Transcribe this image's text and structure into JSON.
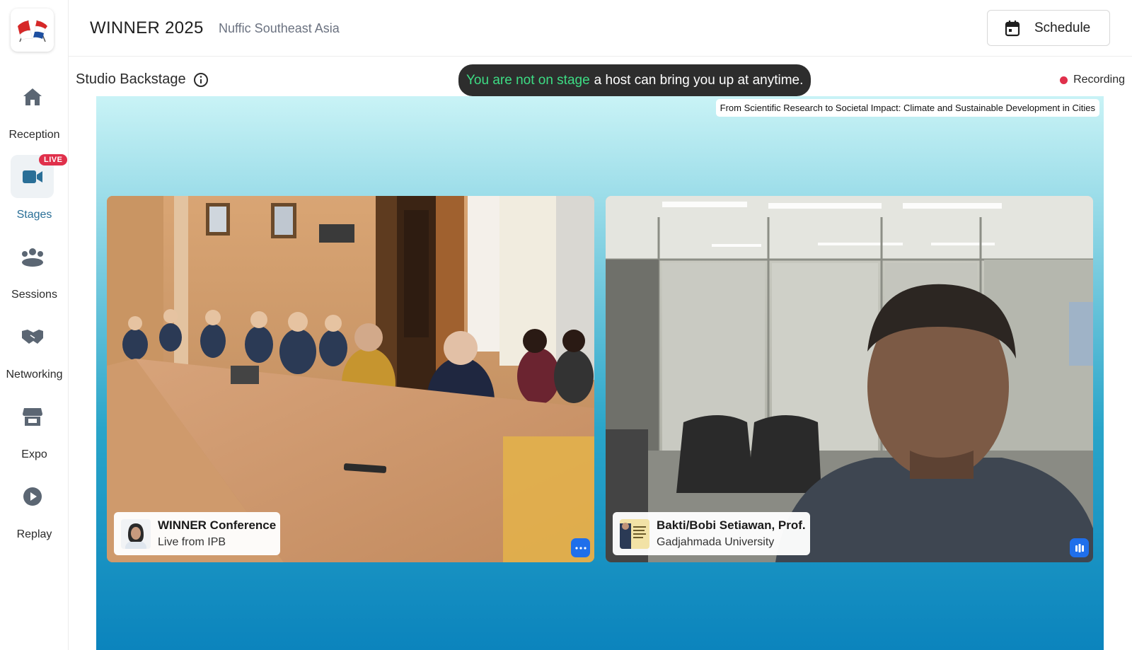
{
  "app": {
    "logo_icon": "netherlands-indonesia-flags-logo"
  },
  "header": {
    "event_title": "WINNER 2025",
    "organization": "Nuffic Southeast Asia",
    "schedule_label": "Schedule"
  },
  "sidebar": {
    "items": [
      {
        "label": "Reception",
        "icon": "home-icon",
        "active": false
      },
      {
        "label": "Stages",
        "icon": "video-camera-icon",
        "active": true,
        "badge": "LIVE"
      },
      {
        "label": "Sessions",
        "icon": "people-group-icon",
        "active": false
      },
      {
        "label": "Networking",
        "icon": "handshake-icon",
        "active": false
      },
      {
        "label": "Expo",
        "icon": "booth-icon",
        "active": false
      },
      {
        "label": "Replay",
        "icon": "play-circle-icon",
        "active": false
      }
    ]
  },
  "studio": {
    "title": "Studio Backstage",
    "notice_highlight": "You are not on stage",
    "notice_rest": "a host can bring you up at anytime.",
    "recording_label": "Recording"
  },
  "stage": {
    "session_title": "From Scientific Research to Societal Impact: Climate and Sustainable Development in Cities",
    "participants": [
      {
        "name": "WINNER Conference",
        "subtitle": "Live from IPB",
        "action_icon": "more-options-icon"
      },
      {
        "name": "Bakti/Bobi Setiawan, Prof.",
        "subtitle": "Gadjahmada University",
        "action_icon": "audio-level-icon"
      }
    ]
  },
  "colors": {
    "accent": "#2a6f97",
    "live_badge": "#e0304b",
    "notice_highlight": "#3ddc84",
    "tile_button": "#1f6feb"
  }
}
